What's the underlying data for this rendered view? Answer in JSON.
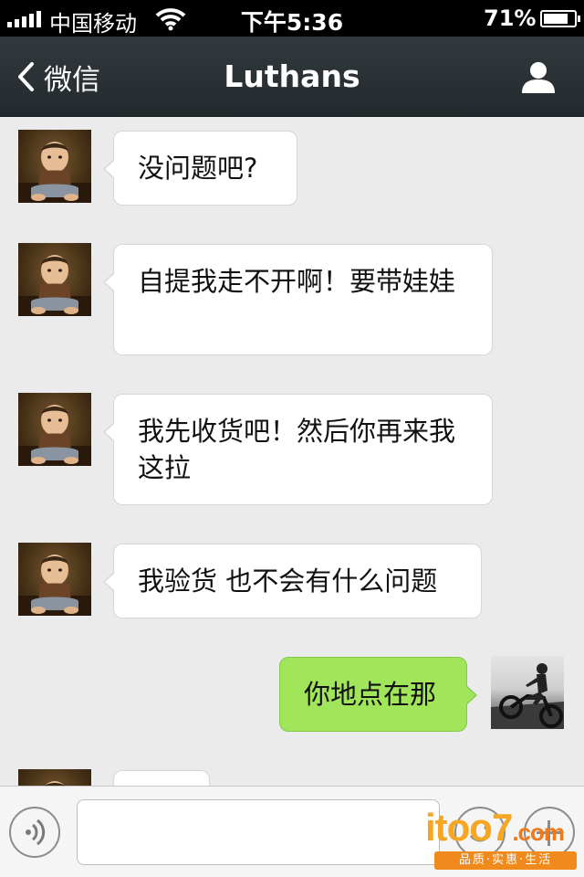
{
  "status_bar": {
    "carrier": "中国移动",
    "time": "下午5:36",
    "battery_percent": "71%"
  },
  "nav": {
    "back_label": "微信",
    "title": "Luthans"
  },
  "messages": [
    {
      "direction": "incoming",
      "text": "没问题吧?"
    },
    {
      "direction": "incoming",
      "text": "自提我走不开啊！要带娃娃"
    },
    {
      "direction": "incoming",
      "text": "我先收货吧！然后你再来我这拉"
    },
    {
      "direction": "incoming",
      "text": "我验货 也不会有什么问题"
    },
    {
      "direction": "outgoing",
      "text": "你地点在那"
    },
    {
      "direction": "incoming",
      "text": ""
    }
  ],
  "input": {
    "placeholder": ""
  },
  "watermark": {
    "logo": "itoo7",
    "domain": ".com",
    "slogan": "品质·实惠·生活"
  },
  "colors": {
    "outgoing_bubble": "#a0e55a",
    "incoming_bubble": "#ffffff",
    "nav_background": "#2d3437",
    "chat_background": "#ebebeb"
  }
}
